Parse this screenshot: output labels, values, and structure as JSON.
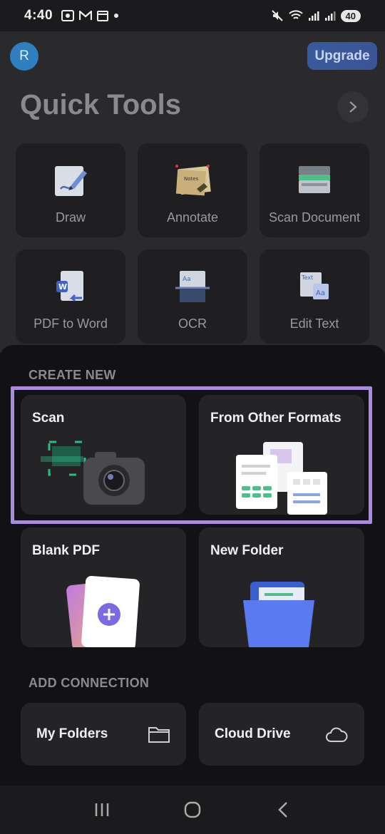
{
  "status": {
    "time": "4:40",
    "battery": "40"
  },
  "header": {
    "avatar_initial": "R",
    "upgrade_label": "Upgrade"
  },
  "quick_tools": {
    "title": "Quick Tools",
    "items": [
      {
        "label": "Draw",
        "icon": "draw-icon"
      },
      {
        "label": "Annotate",
        "icon": "annotate-icon"
      },
      {
        "label": "Scan Document",
        "icon": "scanner-icon"
      },
      {
        "label": "PDF to Word",
        "icon": "pdf-to-word-icon"
      },
      {
        "label": "OCR",
        "icon": "ocr-icon"
      },
      {
        "label": "Edit Text",
        "icon": "edit-text-icon"
      }
    ]
  },
  "create_new": {
    "label": "CREATE NEW",
    "items": [
      {
        "label": "Scan",
        "icon": "camera-icon"
      },
      {
        "label": "From Other Formats",
        "icon": "documents-icon"
      },
      {
        "label": "Blank PDF",
        "icon": "blank-pdf-icon"
      },
      {
        "label": "New Folder",
        "icon": "folder-icon"
      }
    ]
  },
  "connections": {
    "label": "ADD CONNECTION",
    "items": [
      {
        "label": "My Folders",
        "icon": "folder-outline-icon"
      },
      {
        "label": "Cloud Drive",
        "icon": "cloud-icon"
      }
    ]
  },
  "colors": {
    "accent": "#a98be0",
    "upgrade": "#3b5495",
    "avatar": "#2f7fbf"
  }
}
